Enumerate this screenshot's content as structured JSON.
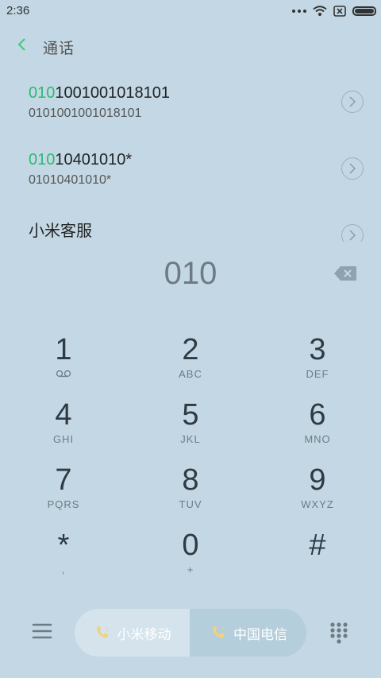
{
  "status": {
    "time": "2:36"
  },
  "header": {
    "title": "通话"
  },
  "results": [
    {
      "match": "010",
      "rest": "1001001018101",
      "sub": "0101001001018101"
    },
    {
      "match": "010",
      "rest": "10401010*",
      "sub": "01010401010*"
    },
    {
      "match": "",
      "rest": "小米客服",
      "sub": ""
    }
  ],
  "dial": {
    "value": "010"
  },
  "keys": [
    {
      "digit": "1",
      "letters": ""
    },
    {
      "digit": "2",
      "letters": "ABC"
    },
    {
      "digit": "3",
      "letters": "DEF"
    },
    {
      "digit": "4",
      "letters": "GHI"
    },
    {
      "digit": "5",
      "letters": "JKL"
    },
    {
      "digit": "6",
      "letters": "MNO"
    },
    {
      "digit": "7",
      "letters": "PQRS"
    },
    {
      "digit": "8",
      "letters": "TUV"
    },
    {
      "digit": "9",
      "letters": "WXYZ"
    },
    {
      "digit": "*",
      "letters": ","
    },
    {
      "digit": "0",
      "letters": "+"
    },
    {
      "digit": "#",
      "letters": ""
    }
  ],
  "bottom": {
    "sim1_label": "小米移动",
    "sim2_label": "中国电信"
  },
  "colors": {
    "background": "#c3d8e4",
    "highlight": "#2eb872",
    "sim_icon": "#f2d27a"
  }
}
